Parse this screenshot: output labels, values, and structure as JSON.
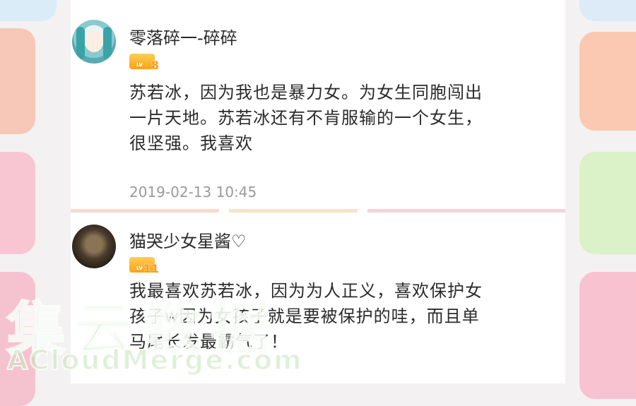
{
  "comments": [
    {
      "username": "零落碎一-碎碎",
      "level": "8",
      "level_prefix": "LV",
      "lines": [
        "苏若冰，因为我也是暴力女。为女生同胞闯出",
        "一片天地。苏若冰还有不肯服输的一个女生，",
        "很坚强。我喜欢"
      ],
      "timestamp": "2019-02-13 10:45"
    },
    {
      "username": "猫哭少女星酱♡",
      "level": "11",
      "level_prefix": "LV",
      "lines": [
        "我最喜欢苏若冰，因为为人正义，喜欢保护女",
        "孩子w因为女孩子就是要被保护的哇，而且单",
        "马尾长发最霸气了！"
      ]
    }
  ],
  "watermark": {
    "chinese": "集云数据",
    "english": "ACloudMerge.com"
  }
}
